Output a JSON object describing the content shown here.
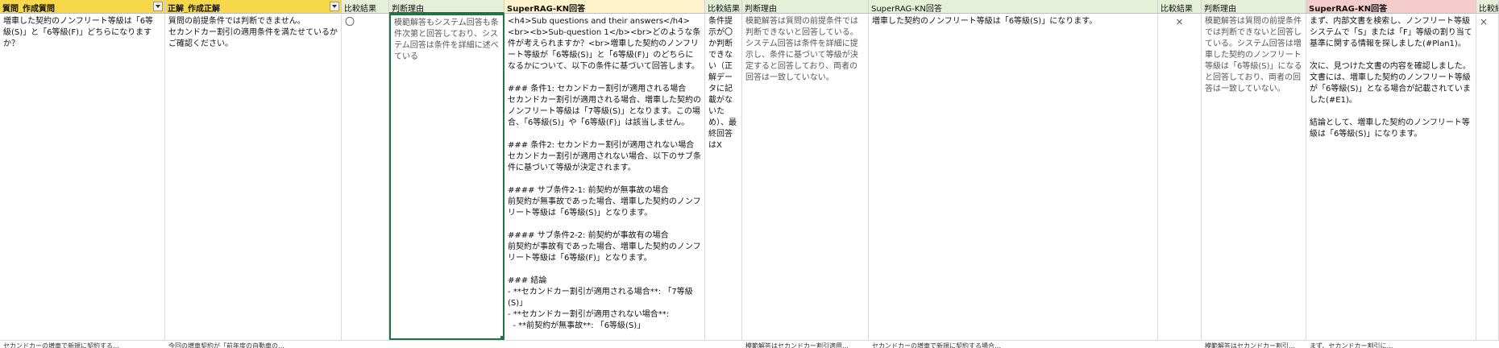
{
  "headers": [
    "質問_作成質問",
    "正解_作成正解",
    "比較結果",
    "判断理由",
    "SuperRAG-KN回答",
    "比較結果",
    "判断理由",
    "SuperRAG-KN回答",
    "比較結果",
    "判断理由",
    "SuperRAG-KN回答",
    "比較結果"
  ],
  "row1": {
    "question": "増車した契約のノンフリート等級は「6等級(S)」と「6等級(F)」どちらになりますか？",
    "answer": "質問の前提条件では判断できません。\nセカンドカー割引の適用条件を満たせているかご確認ください。",
    "compare1": "〇",
    "reason1": "模範解答もシステム回答も条件次第と回答しており、システム回答は条件を詳細に述べている",
    "rag1": "<h4>Sub questions and their answers</h4><br><b>Sub-question 1</b><br>どのような条件が考えられますか？<br>増車した契約のノンフリート等級が「6等級(S)」と「6等級(F)」のどちらになるかについて、以下の条件に基づいて回答します。\n\n### 条件1: セカンドカー割引が適用される場合\nセカンドカー割引が適用される場合、増車した契約のノンフリート等級は「7等級(S)」となります。この場合、「6等級(S)」や「6等級(F)」は該当しません。\n\n### 条件2: セカンドカー割引が適用されない場合\nセカンドカー割引が適用されない場合、以下のサブ条件に基づいて等級が決定されます。\n\n#### サブ条件2-1: 前契約が無事故の場合\n前契約が無事故であった場合、増車した契約のノンフリート等級は「6等級(S)」となります。\n\n#### サブ条件2-2: 前契約が事故有の場合\n前契約が事故有であった場合、増車した契約のノンフリート等級は「6等級(F)」となります。\n\n### 結論\n- **セカンドカー割引が適用される場合**: 「7等級(S)」\n- **セカンドカー割引が適用されない場合**:\n  - **前契約が無事故**: 「6等級(S)」",
    "compare2": "条件提示が〇か判断できない（正解データに記載がないため）、最終回答はX",
    "reason2": "模範解答は質問の前提条件では判断できないと回答している。システム回答は条件を詳細に提示し、条件に基づいて等級が決定すると回答しており、両者の回答は一致していない。",
    "rag2": "増車した契約のノンフリート等級は「6等級(S)」になります。",
    "compare3": "×",
    "reason3": "模範解答は質問の前提条件では判断できないと回答している。システム回答は増車した契約のノンフリート等級は「6等級(S)」になると回答しており、両者の回答は一致していない。",
    "rag3": "まず、内部文書を検索し、ノンフリート等級システムで「S」または「F」等級の割り当て基準に関する情報を探しました(#Plan1)。\n\n次に、見つけた文書の内容を確認しました。文書には、増車した契約のノンフリート等級が「6等級(S)」となる場合が記載されていました(#E1)。\n\n結論として、増車した契約のノンフリート等級は「6等級(S)」になります。",
    "compare4": "×"
  },
  "row2": {
    "question": "セカンドカーの増車で新規に契約する…",
    "answer": "今回の増車契約が「前年度の自動車の…",
    "reason2": "模範解答はセカンドカー割引適用…",
    "rag2": "セカンドカーの増車で新規に契約する場合…",
    "reason3": "模範解答はセカンドカー割引…",
    "rag3": "まず、セカンドカー割引に…"
  }
}
